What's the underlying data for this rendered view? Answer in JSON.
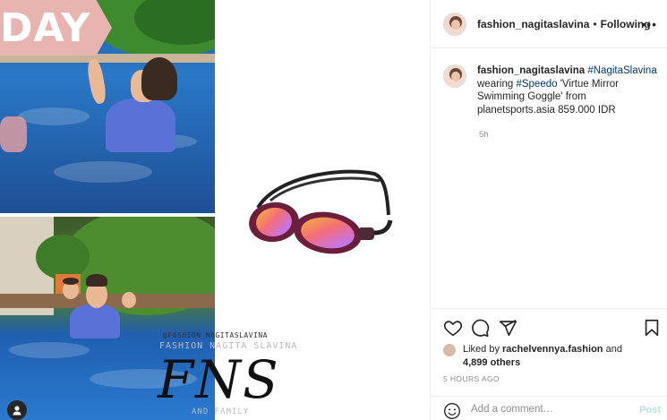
{
  "media": {
    "banner_text": "DAY",
    "watermark": {
      "handle": "@FASHION_NAGITASLAVINA",
      "line": "FASHION NAGITA SLAVINA",
      "monogram": "FNS",
      "footer": "AND FAMILY"
    }
  },
  "header": {
    "username": "fashion_nagitaslavina",
    "separator": "•",
    "follow_status": "Following",
    "more_icon": "more-horizontal-icon"
  },
  "caption": {
    "username": "fashion_nagitaslavina",
    "hashtag1": "#NagitaSlavina",
    "text1": " wearing ",
    "hashtag2": "#Speedo",
    "text2": " 'Virtue Mirror Swimming Goggle' from planetsports.asia 859.000 IDR",
    "time": "5h"
  },
  "actions": {
    "icons": [
      "heart-icon",
      "comment-icon",
      "share-icon",
      "bookmark-icon"
    ],
    "liked_by_prefix": "Liked by ",
    "liked_by_user": "rachelvennya.fashion",
    "liked_by_and": " and",
    "likes_count": "4,899 others",
    "post_time": "5 HOURS AGO"
  },
  "comment": {
    "placeholder": "Add a comment…",
    "post_label": "Post"
  }
}
